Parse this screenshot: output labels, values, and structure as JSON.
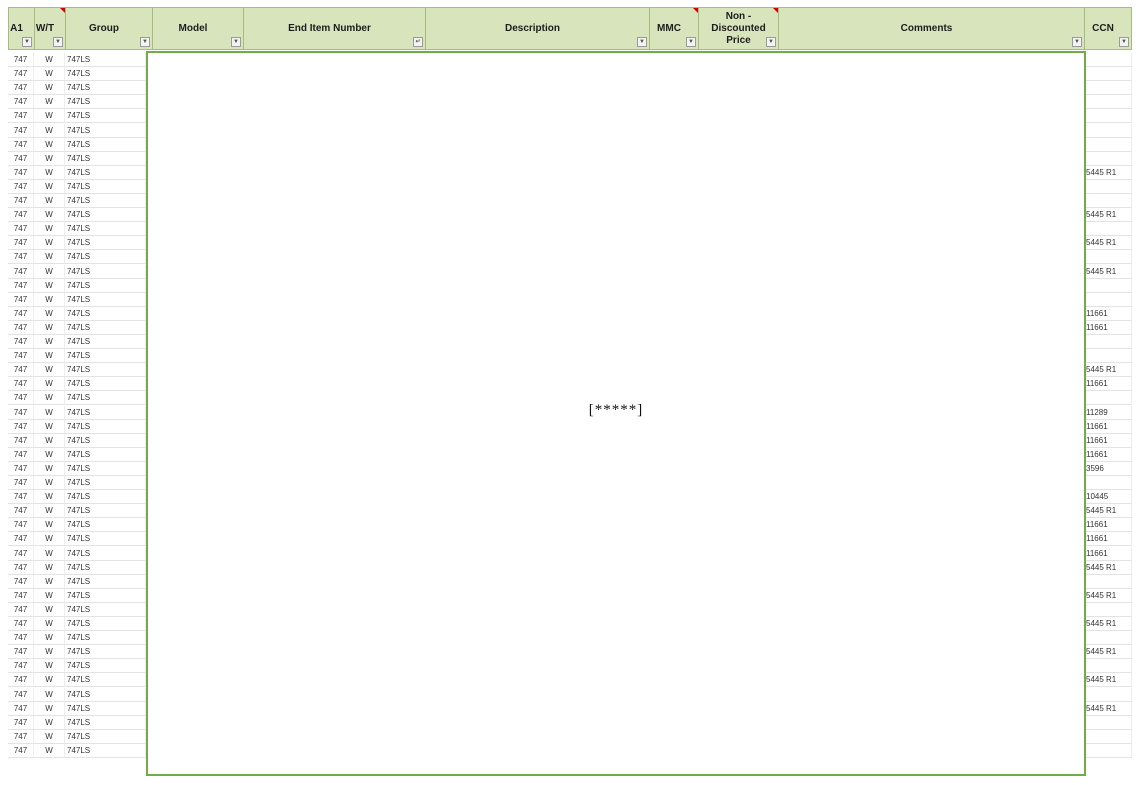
{
  "header": {
    "columns": [
      {
        "key": "a1",
        "label": "A1",
        "filter_icon": "filter-dropdown-icon",
        "comment_marker": false
      },
      {
        "key": "wt",
        "label": "W/T",
        "filter_icon": "filter-dropdown-icon",
        "comment_marker": true
      },
      {
        "key": "group",
        "label": "Group",
        "filter_icon": "filter-dropdown-icon",
        "comment_marker": false
      },
      {
        "key": "model",
        "label": "Model",
        "filter_icon": "filter-dropdown-icon",
        "comment_marker": false
      },
      {
        "key": "end_item_number",
        "label": "End Item Number",
        "filter_icon": "filter-active-icon",
        "comment_marker": false
      },
      {
        "key": "description",
        "label": "Description",
        "filter_icon": "filter-dropdown-icon",
        "comment_marker": false
      },
      {
        "key": "mmc",
        "label": "MMC",
        "filter_icon": "filter-dropdown-icon",
        "comment_marker": true
      },
      {
        "key": "price",
        "label": "Non - Discounted Price",
        "filter_icon": "filter-dropdown-icon",
        "comment_marker": true
      },
      {
        "key": "comments",
        "label": "Comments",
        "filter_icon": "filter-dropdown-icon",
        "comment_marker": false
      },
      {
        "key": "ccn",
        "label": "CCN",
        "filter_icon": "filter-dropdown-icon",
        "comment_marker": false
      }
    ]
  },
  "rows": [
    {
      "a1": "747",
      "wt": "W",
      "group": "747LS",
      "ccn": ""
    },
    {
      "a1": "747",
      "wt": "W",
      "group": "747LS",
      "ccn": ""
    },
    {
      "a1": "747",
      "wt": "W",
      "group": "747LS",
      "ccn": ""
    },
    {
      "a1": "747",
      "wt": "W",
      "group": "747LS",
      "ccn": ""
    },
    {
      "a1": "747",
      "wt": "W",
      "group": "747LS",
      "ccn": ""
    },
    {
      "a1": "747",
      "wt": "W",
      "group": "747LS",
      "ccn": ""
    },
    {
      "a1": "747",
      "wt": "W",
      "group": "747LS",
      "ccn": ""
    },
    {
      "a1": "747",
      "wt": "W",
      "group": "747LS",
      "ccn": ""
    },
    {
      "a1": "747",
      "wt": "W",
      "group": "747LS",
      "ccn": "5445 R1"
    },
    {
      "a1": "747",
      "wt": "W",
      "group": "747LS",
      "ccn": ""
    },
    {
      "a1": "747",
      "wt": "W",
      "group": "747LS",
      "ccn": ""
    },
    {
      "a1": "747",
      "wt": "W",
      "group": "747LS",
      "ccn": "5445 R1"
    },
    {
      "a1": "747",
      "wt": "W",
      "group": "747LS",
      "ccn": ""
    },
    {
      "a1": "747",
      "wt": "W",
      "group": "747LS",
      "ccn": "5445 R1"
    },
    {
      "a1": "747",
      "wt": "W",
      "group": "747LS",
      "ccn": ""
    },
    {
      "a1": "747",
      "wt": "W",
      "group": "747LS",
      "ccn": "5445 R1"
    },
    {
      "a1": "747",
      "wt": "W",
      "group": "747LS",
      "ccn": ""
    },
    {
      "a1": "747",
      "wt": "W",
      "group": "747LS",
      "ccn": ""
    },
    {
      "a1": "747",
      "wt": "W",
      "group": "747LS",
      "ccn": "11661"
    },
    {
      "a1": "747",
      "wt": "W",
      "group": "747LS",
      "ccn": "11661"
    },
    {
      "a1": "747",
      "wt": "W",
      "group": "747LS",
      "ccn": ""
    },
    {
      "a1": "747",
      "wt": "W",
      "group": "747LS",
      "ccn": ""
    },
    {
      "a1": "747",
      "wt": "W",
      "group": "747LS",
      "ccn": "5445 R1"
    },
    {
      "a1": "747",
      "wt": "W",
      "group": "747LS",
      "ccn": "11661"
    },
    {
      "a1": "747",
      "wt": "W",
      "group": "747LS",
      "ccn": ""
    },
    {
      "a1": "747",
      "wt": "W",
      "group": "747LS",
      "ccn": "11289"
    },
    {
      "a1": "747",
      "wt": "W",
      "group": "747LS",
      "ccn": "11661"
    },
    {
      "a1": "747",
      "wt": "W",
      "group": "747LS",
      "ccn": "11661"
    },
    {
      "a1": "747",
      "wt": "W",
      "group": "747LS",
      "ccn": "11661"
    },
    {
      "a1": "747",
      "wt": "W",
      "group": "747LS",
      "ccn": "3596"
    },
    {
      "a1": "747",
      "wt": "W",
      "group": "747LS",
      "ccn": ""
    },
    {
      "a1": "747",
      "wt": "W",
      "group": "747LS",
      "ccn": "10445"
    },
    {
      "a1": "747",
      "wt": "W",
      "group": "747LS",
      "ccn": "5445 R1"
    },
    {
      "a1": "747",
      "wt": "W",
      "group": "747LS",
      "ccn": "11661"
    },
    {
      "a1": "747",
      "wt": "W",
      "group": "747LS",
      "ccn": "11661"
    },
    {
      "a1": "747",
      "wt": "W",
      "group": "747LS",
      "ccn": "11661"
    },
    {
      "a1": "747",
      "wt": "W",
      "group": "747LS",
      "ccn": "5445 R1"
    },
    {
      "a1": "747",
      "wt": "W",
      "group": "747LS",
      "ccn": ""
    },
    {
      "a1": "747",
      "wt": "W",
      "group": "747LS",
      "ccn": "5445 R1"
    },
    {
      "a1": "747",
      "wt": "W",
      "group": "747LS",
      "ccn": ""
    },
    {
      "a1": "747",
      "wt": "W",
      "group": "747LS",
      "ccn": "5445 R1"
    },
    {
      "a1": "747",
      "wt": "W",
      "group": "747LS",
      "ccn": ""
    },
    {
      "a1": "747",
      "wt": "W",
      "group": "747LS",
      "ccn": "5445 R1"
    },
    {
      "a1": "747",
      "wt": "W",
      "group": "747LS",
      "ccn": ""
    },
    {
      "a1": "747",
      "wt": "W",
      "group": "747LS",
      "ccn": "5445 R1"
    },
    {
      "a1": "747",
      "wt": "W",
      "group": "747LS",
      "ccn": ""
    },
    {
      "a1": "747",
      "wt": "W",
      "group": "747LS",
      "ccn": "5445 R1"
    },
    {
      "a1": "747",
      "wt": "W",
      "group": "747LS",
      "ccn": ""
    },
    {
      "a1": "747",
      "wt": "W",
      "group": "747LS",
      "ccn": ""
    },
    {
      "a1": "747",
      "wt": "W",
      "group": "747LS",
      "ccn": ""
    }
  ],
  "redaction": {
    "text": "[*****]"
  },
  "colors": {
    "header_fill": "#d8e4bc",
    "header_border": "#a6bd7a",
    "redaction_border": "#70ad47",
    "comment_marker": "#d00000"
  }
}
